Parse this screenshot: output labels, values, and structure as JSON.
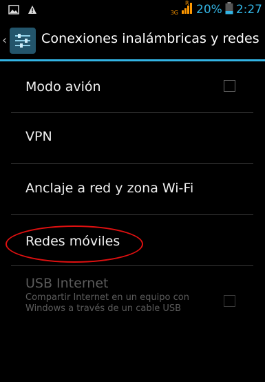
{
  "status_bar": {
    "network_type": "3G",
    "network_roaming": "R",
    "battery_percent": "20%",
    "time": "2:27",
    "accent_color": "#33b5e5"
  },
  "action_bar": {
    "title": "Conexiones inalámbricas y redes",
    "icon": "settings-sliders-icon"
  },
  "settings": {
    "items": [
      {
        "label": "Modo avión",
        "has_checkbox": true,
        "checked": false,
        "enabled": true
      },
      {
        "label": "VPN",
        "enabled": true
      },
      {
        "label": "Anclaje a red y zona Wi-Fi",
        "enabled": true
      },
      {
        "label": "Redes móviles",
        "enabled": true,
        "highlighted": true
      },
      {
        "label": "USB Internet",
        "summary": "Compartir Internet en un equipo con Windows a través de un cable USB",
        "has_checkbox": true,
        "checked": false,
        "enabled": false
      }
    ]
  },
  "highlight_color": "#e01010"
}
